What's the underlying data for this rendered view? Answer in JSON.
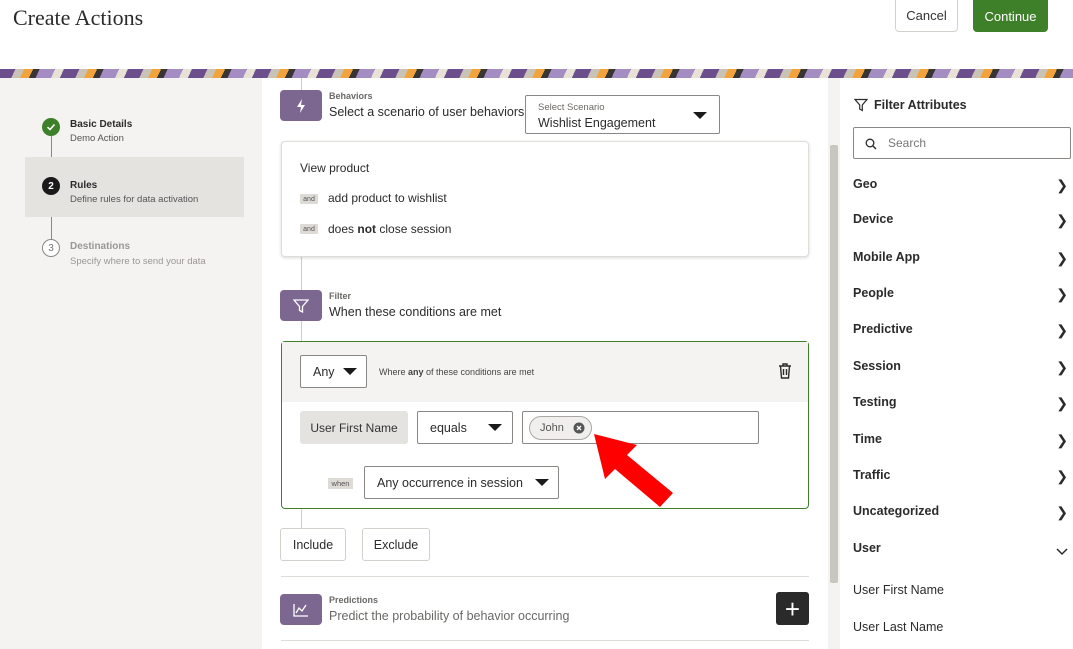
{
  "header": {
    "title": "Create Actions",
    "cancel_label": "Cancel",
    "continue_label": "Continue"
  },
  "steps": [
    {
      "title": "Basic Details",
      "subtitle": "Demo Action",
      "marker": "",
      "state": "done"
    },
    {
      "title": "Rules",
      "subtitle": "Define rules for data activation",
      "marker": "2",
      "state": "active"
    },
    {
      "title": "Destinations",
      "subtitle": "Specify where to send your data",
      "marker": "3",
      "state": "pending"
    }
  ],
  "behaviors": {
    "label": "Behaviors",
    "description": "Select a scenario of user behaviors",
    "select_label": "Select Scenario",
    "select_value": "Wishlist Engagement",
    "first_line": "View product",
    "and_tag": "and",
    "line2": "add product to wishlist",
    "line3_pre": "does ",
    "line3_bold": "not",
    "line3_post": " close session"
  },
  "filter": {
    "label": "Filter",
    "description": "When these conditions are met",
    "match_value": "Any",
    "match_text_pre": "Where ",
    "match_text_bold": "any",
    "match_text_post": " of these conditions are met",
    "condition_attribute": "User First Name",
    "operator": "equals",
    "value_token": "John",
    "when_tag": "when",
    "occurrence": "Any occurrence in session",
    "include_label": "Include",
    "exclude_label": "Exclude"
  },
  "predictions": {
    "label": "Predictions",
    "description": "Predict the probability of behavior occurring",
    "add_symbol": "+"
  },
  "filter_attributes": {
    "title": "Filter Attributes",
    "search_placeholder": "Search",
    "categories": [
      "Geo",
      "Device",
      "Mobile App",
      "People",
      "Predictive",
      "Session",
      "Testing",
      "Time",
      "Traffic",
      "Uncategorized",
      "User"
    ],
    "expanded_category": "User",
    "user_items": [
      "User First Name",
      "User Last Name"
    ]
  },
  "colors": {
    "accent_green": "#3e7f2a",
    "section_purple": "#7c6791",
    "arrow_red": "#ff0000"
  },
  "icons": [
    "check-icon",
    "lightning-icon",
    "funnel-icon",
    "trash-icon",
    "close-circle-icon",
    "chart-icon",
    "plus-icon",
    "search-icon",
    "chevron-right-icon",
    "chevron-down-icon"
  ]
}
